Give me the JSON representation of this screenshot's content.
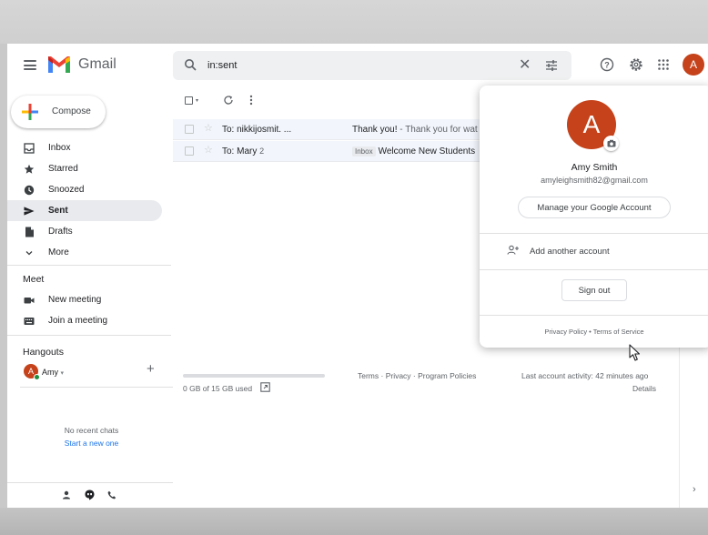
{
  "app": {
    "name": "Gmail"
  },
  "search": {
    "value": "in:sent"
  },
  "compose": {
    "label": "Compose"
  },
  "sidebar": {
    "items": [
      {
        "label": "Inbox",
        "icon": "inbox-icon"
      },
      {
        "label": "Starred",
        "icon": "star-icon"
      },
      {
        "label": "Snoozed",
        "icon": "clock-icon"
      },
      {
        "label": "Sent",
        "icon": "send-icon",
        "active": true
      },
      {
        "label": "Drafts",
        "icon": "draft-icon"
      },
      {
        "label": "More",
        "icon": "chevron-down-icon"
      }
    ]
  },
  "meet": {
    "title": "Meet",
    "new_meeting": "New meeting",
    "join_meeting": "Join a meeting"
  },
  "hangouts": {
    "title": "Hangouts",
    "user": "Amy",
    "user_initial": "A",
    "no_chats": "No recent chats",
    "start_new": "Start a new one"
  },
  "mail": {
    "rows": [
      {
        "to": "To: nikkijosmit. ...",
        "count": "",
        "badge": "",
        "subject": "Thank you!",
        "snippet": " - Thank you for wat"
      },
      {
        "to": "To: Mary",
        "count": "2",
        "badge": "Inbox",
        "subject": "Welcome New Students",
        "snippet": ""
      }
    ]
  },
  "footer": {
    "storage": "0 GB of 15 GB used",
    "terms": "Terms · Privacy · Program Policies",
    "activity": "Last account activity: 42 minutes ago",
    "details": "Details"
  },
  "account": {
    "initial": "A",
    "name": "Amy Smith",
    "email": "amyleighsmith82@gmail.com",
    "manage": "Manage your Google Account",
    "add_account": "Add another account",
    "sign_out": "Sign out",
    "privacy": "Privacy Policy",
    "terms": "Terms of Service"
  },
  "colors": {
    "avatar": "#c5421a",
    "active_nav": "#e8eaed",
    "link": "#1a73e8"
  }
}
